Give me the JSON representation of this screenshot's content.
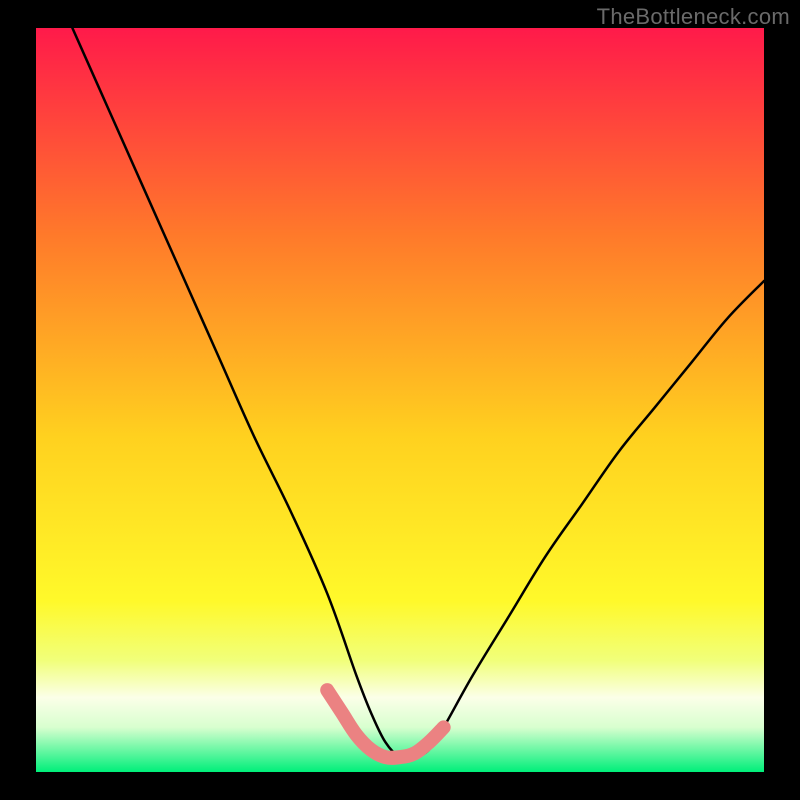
{
  "watermark": "TheBottleneck.com",
  "chart_data": {
    "type": "line",
    "title": "",
    "xlabel": "",
    "ylabel": "",
    "xlim": [
      0,
      100
    ],
    "ylim": [
      0,
      100
    ],
    "grid": false,
    "legend": false,
    "background": {
      "top_color": "#ff1a4a",
      "mid_high_color": "#ff9e2c",
      "mid_color": "#ffe83a",
      "low_yellowgreen": "#e6ff66",
      "pale_band": "#f6ffe8",
      "bottom_color": "#00ef7a"
    },
    "series": [
      {
        "name": "black-curve",
        "type": "line",
        "x": [
          5,
          10,
          15,
          20,
          25,
          30,
          35,
          40,
          44,
          46,
          48,
          50,
          52,
          54,
          56,
          60,
          65,
          70,
          75,
          80,
          85,
          90,
          95,
          100
        ],
        "y": [
          100,
          89,
          78,
          67,
          56,
          45,
          35,
          24,
          13,
          8,
          4,
          2,
          2,
          3,
          6,
          13,
          21,
          29,
          36,
          43,
          49,
          55,
          61,
          66
        ]
      },
      {
        "name": "salmon-highlight",
        "type": "line",
        "x": [
          40,
          42,
          44,
          46,
          48,
          50,
          52,
          54,
          56
        ],
        "y": [
          11,
          8,
          5,
          3,
          2,
          2,
          2.5,
          4,
          6
        ]
      }
    ]
  }
}
